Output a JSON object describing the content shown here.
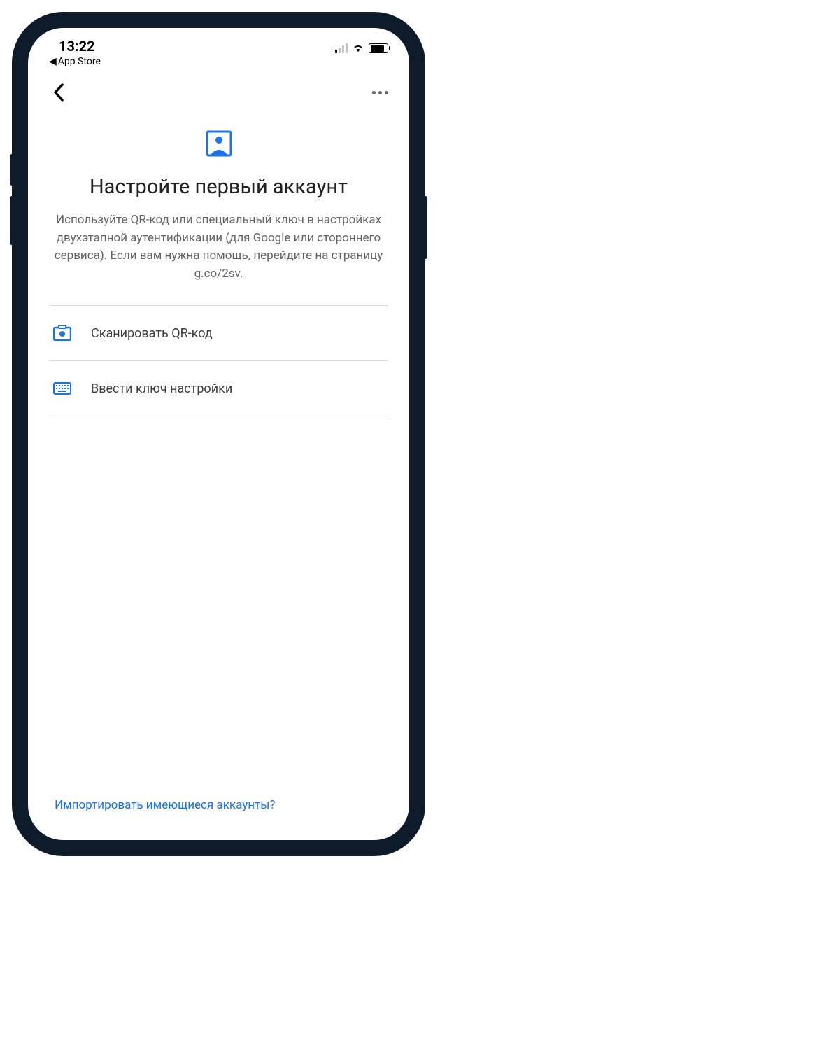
{
  "status": {
    "time": "13:22",
    "back_app": "App Store"
  },
  "header": {
    "title": "Настройте первый аккаунт",
    "description": "Используйте QR-код или специальный ключ в настройках двухэтапной аутентификации (для Google или стороннего сервиса). Если вам нужна помощь, перейдите на страницу g.co/2sv."
  },
  "options": {
    "scan_qr": "Сканировать QR-код",
    "enter_key": "Ввести ключ настройки"
  },
  "footer": {
    "import_link": "Импортировать имеющиеся аккаунты?"
  },
  "colors": {
    "accent": "#1a73e8",
    "text_primary": "#202124",
    "text_secondary": "#5f6368"
  }
}
